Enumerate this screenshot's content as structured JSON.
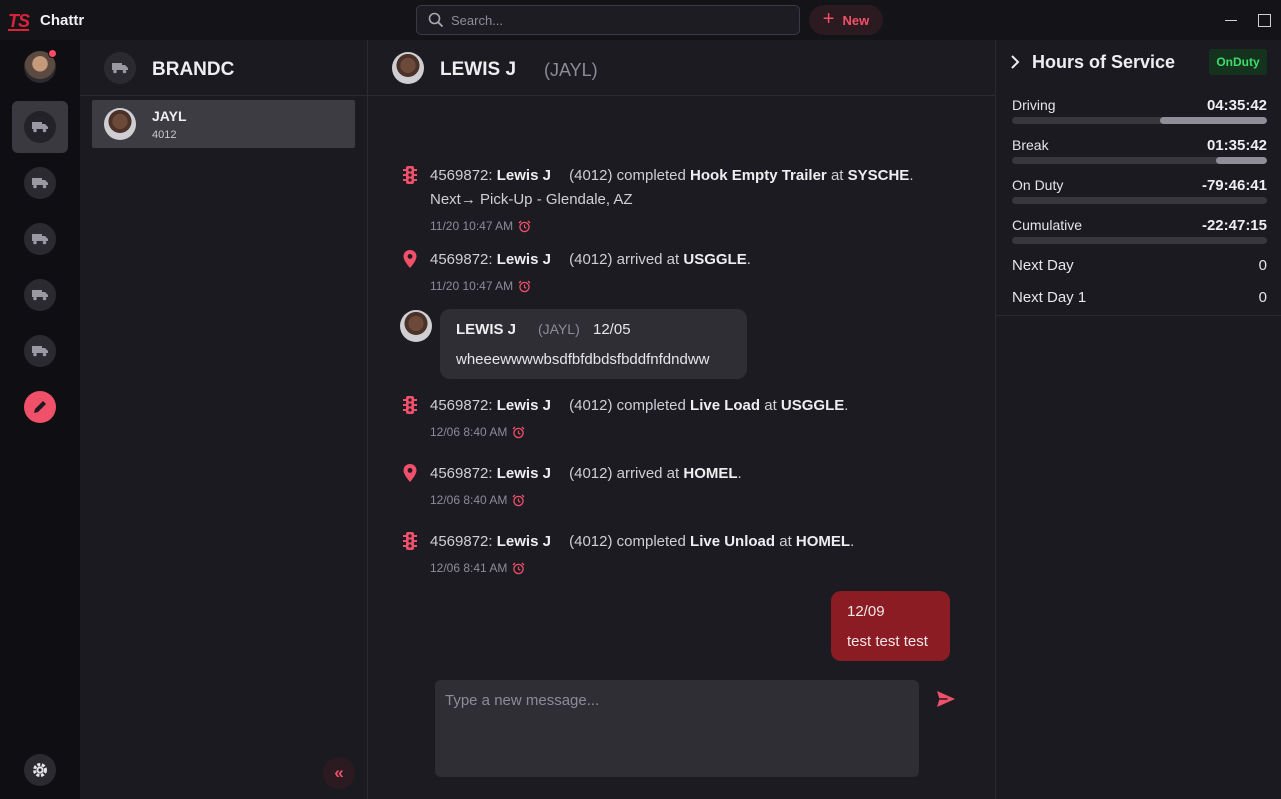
{
  "app": {
    "logo": "TS",
    "name": "Chattr"
  },
  "search": {
    "placeholder": "Search..."
  },
  "toolbar": {
    "new_label": "New"
  },
  "colors": {
    "accent": "#f0506a",
    "outgoing_bubble": "#8c1c24",
    "status_green": "#3ddc6b"
  },
  "conversations": {
    "title": "BRANDC",
    "items": [
      {
        "name": "JAYL",
        "sub": "4012"
      }
    ]
  },
  "chat": {
    "name": "LEWIS J",
    "handle": "(JAYL)",
    "events": [
      {
        "prefix": "4569872:",
        "driver": "Lewis J",
        "driver_id": "(4012)",
        "verb": "completed",
        "action": "Hook Empty Trailer",
        "at": "at",
        "location": "SYSCHE",
        "next_label": "Next",
        "next_text": "Pick-Up - Glendale, AZ",
        "time": "11/20 10:47 AM",
        "icon": "traffic-light-icon"
      },
      {
        "prefix": "4569872:",
        "driver": "Lewis J",
        "driver_id": "(4012)",
        "verb": "arrived at",
        "location": "USGGLE",
        "time": "11/20 10:47 AM",
        "icon": "map-pin-icon"
      },
      {
        "prefix": "4569872:",
        "driver": "Lewis J",
        "driver_id": "(4012)",
        "verb": "completed",
        "action": "Live Load",
        "at": "at",
        "location": "USGGLE",
        "time": "12/06 8:40 AM",
        "icon": "traffic-light-icon"
      },
      {
        "prefix": "4569872:",
        "driver": "Lewis J",
        "driver_id": "(4012)",
        "verb": "arrived at",
        "location": "HOMEL",
        "time": "12/06 8:40 AM",
        "icon": "map-pin-icon"
      },
      {
        "prefix": "4569872:",
        "driver": "Lewis J",
        "driver_id": "(4012)",
        "verb": "completed",
        "action": "Live Unload",
        "at": "at",
        "location": "HOMEL",
        "time": "12/06 8:41 AM",
        "icon": "traffic-light-icon"
      }
    ],
    "incoming": {
      "name": "LEWIS J",
      "handle": "(JAYL)",
      "date": "12/05",
      "text": "wheeewwwwbsdfbfdbdsfbddfnfdndww"
    },
    "outgoing": {
      "date": "12/09",
      "text": "test test test"
    },
    "composer": {
      "placeholder": "Type a new message..."
    }
  },
  "hos": {
    "title": "Hours of Service",
    "status": "OnDuty",
    "rows": [
      {
        "label": "Driving",
        "value": "04:35:42",
        "fill": 0.42
      },
      {
        "label": "Break",
        "value": "01:35:42",
        "fill": 0.2
      },
      {
        "label": "On Duty",
        "value": "-79:46:41",
        "fill": 0
      },
      {
        "label": "Cumulative",
        "value": "-22:47:15",
        "fill": 0
      }
    ],
    "plain": [
      {
        "label": "Next Day",
        "value": "0"
      },
      {
        "label": "Next Day 1",
        "value": "0"
      }
    ]
  }
}
